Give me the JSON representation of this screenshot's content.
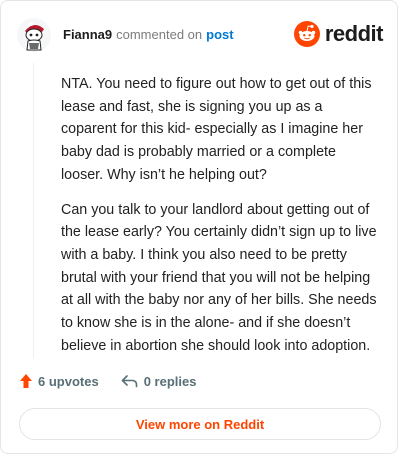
{
  "comment": {
    "username": "Fianna9",
    "action_text": "commented on",
    "post_link_text": "post",
    "paragraphs": [
      "NTA. You need to figure out how to get out of this lease and fast, she is signing you up as a coparent for this kid- especially as I imagine her baby dad is probably married or a complete looser. Why isn’t he helping out?",
      "Can you talk to your landlord about getting out of the lease early? You certainly didn’t sign up to live with a baby. I think you also need to be pretty brutal with your friend that you will not be helping at all with the baby nor any of her bills. She needs to know she is in the alone- and if she doesn’t believe in abortion she should look into adoption."
    ]
  },
  "brand": {
    "name": "reddit",
    "icon": "reddit-logo-icon",
    "color": "#ff4500"
  },
  "footer": {
    "upvotes_label": "6 upvotes",
    "replies_label": "0 replies",
    "upvote_icon": "upvote-arrow-icon",
    "reply_icon": "reply-arrow-icon",
    "upvote_color": "#ff4500"
  },
  "view_more_label": "View more on Reddit"
}
